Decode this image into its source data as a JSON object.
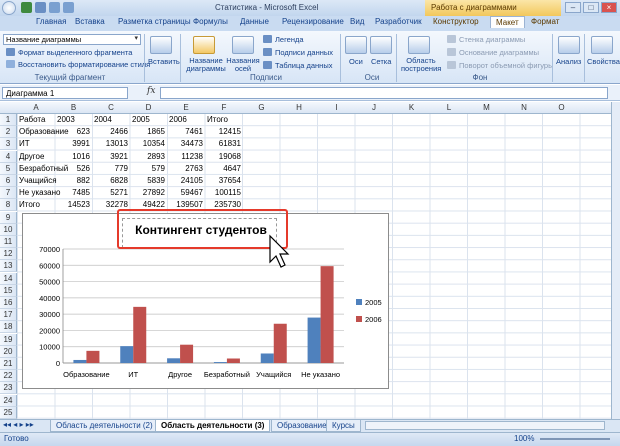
{
  "window": {
    "title": "Статистика - Microsoft Excel",
    "context_title": "Работа с диаграммами"
  },
  "tabs": [
    "Главная",
    "Вставка",
    "Разметка страницы",
    "Формулы",
    "Данные",
    "Рецензирование",
    "Вид",
    "Разработчик",
    "Конструктор",
    "Макет",
    "Формат"
  ],
  "active_tab": "Макет",
  "ribbon": {
    "fragment": {
      "dropdown": "Название диаграммы",
      "format": "Формат выделенного фрагмента",
      "reset": "Восстановить форматирование стиля",
      "label": "Текущий фрагмент"
    },
    "insert": "Вставить",
    "chart_title": "Название диаграммы",
    "axis_titles": "Названия осей",
    "legend": "Легенда",
    "data_labels": "Подписи данных",
    "data_table": "Таблица данных",
    "labels_group": "Подписи",
    "axes": "Оси",
    "gridlines": "Сетка",
    "axes_group": "Оси",
    "plot_area": "Область построения",
    "chart_wall": "Стенка диаграммы",
    "chart_floor": "Основание диаграммы",
    "rotation": "Поворот объемной фигуры",
    "bg_group": "Фон",
    "analysis": "Анализ",
    "properties": "Свойства"
  },
  "formula_bar": {
    "name_box": "Диаграмма 1",
    "fx": "fx",
    "formula": ""
  },
  "columns": [
    "A",
    "B",
    "C",
    "D",
    "E",
    "F",
    "G",
    "H",
    "I",
    "J",
    "K",
    "L",
    "M",
    "N",
    "O"
  ],
  "rows": [
    "1",
    "2",
    "3",
    "4",
    "5",
    "6",
    "7",
    "8",
    "9",
    "10",
    "11",
    "12",
    "13",
    "14",
    "15",
    "16",
    "17",
    "18",
    "19",
    "20",
    "21",
    "22",
    "23",
    "24",
    "25"
  ],
  "table": {
    "header": [
      "Работа",
      "2003",
      "2004",
      "2005",
      "2006",
      "Итого"
    ],
    "rows": [
      [
        "Образование",
        "623",
        "2466",
        "1865",
        "7461",
        "12415"
      ],
      [
        "ИТ",
        "3991",
        "13013",
        "10354",
        "34473",
        "61831"
      ],
      [
        "Другое",
        "1016",
        "3921",
        "2893",
        "11238",
        "19068"
      ],
      [
        "Безработный",
        "526",
        "779",
        "579",
        "2763",
        "4647"
      ],
      [
        "Учащийся",
        "882",
        "6828",
        "5839",
        "24105",
        "37654"
      ],
      [
        "Не указано",
        "7485",
        "5271",
        "27892",
        "59467",
        "100115"
      ],
      [
        "Итого",
        "14523",
        "32278",
        "49422",
        "139507",
        "235730"
      ]
    ]
  },
  "chart_data": {
    "type": "bar",
    "title": "Контингент студентов",
    "categories": [
      "Образование",
      "ИТ",
      "Другое",
      "Безработный",
      "Учащийся",
      "Не указано"
    ],
    "series": [
      {
        "name": "2005",
        "values": [
          1865,
          10354,
          2893,
          579,
          5839,
          27892
        ],
        "color": "#4f81bd"
      },
      {
        "name": "2006",
        "values": [
          7461,
          34473,
          11238,
          2763,
          24105,
          59467
        ],
        "color": "#c0504d"
      }
    ],
    "ylim": [
      0,
      70000
    ],
    "yticks": [
      "0",
      "10000",
      "20000",
      "30000",
      "40000",
      "50000",
      "60000",
      "70000"
    ],
    "grid": true,
    "legend_position": "right"
  },
  "sheet_tabs": [
    "Область деятельности (2)",
    "Область деятельности (3)",
    "Образование",
    "Курсы"
  ],
  "active_sheet": "Область деятельности (3)",
  "status": {
    "ready": "Готово",
    "zoom": "100%"
  }
}
